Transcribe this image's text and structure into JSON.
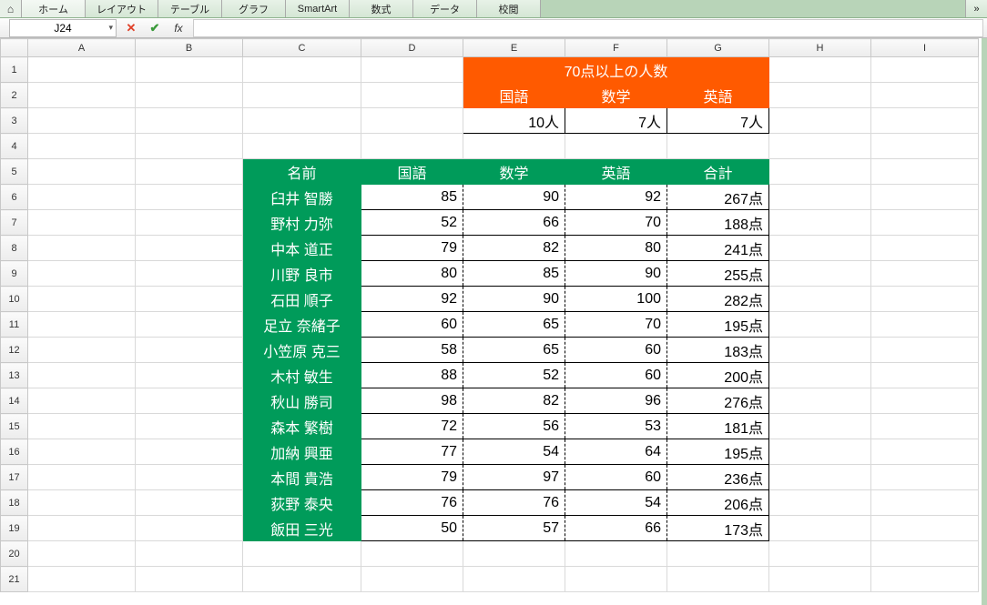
{
  "ribbon": {
    "tabs": [
      "ホーム",
      "レイアウト",
      "テーブル",
      "グラフ",
      "SmartArt",
      "数式",
      "データ",
      "校閲"
    ],
    "active": 0,
    "menu_glyph": "»"
  },
  "namebox": "J24",
  "columns": [
    "A",
    "B",
    "C",
    "D",
    "E",
    "F",
    "G",
    "H",
    "I"
  ],
  "summary": {
    "title": "70点以上の人数",
    "labels": [
      "国語",
      "数学",
      "英語"
    ],
    "counts": [
      "10人",
      "7人",
      "7人"
    ]
  },
  "table": {
    "headers": [
      "名前",
      "国語",
      "数学",
      "英語",
      "合計"
    ],
    "rows": [
      {
        "name": "臼井 智勝",
        "kokugo": 85,
        "sugaku": 90,
        "eigo": 92,
        "total": "267点"
      },
      {
        "name": "野村 力弥",
        "kokugo": 52,
        "sugaku": 66,
        "eigo": 70,
        "total": "188点"
      },
      {
        "name": "中本 道正",
        "kokugo": 79,
        "sugaku": 82,
        "eigo": 80,
        "total": "241点"
      },
      {
        "name": "川野 良市",
        "kokugo": 80,
        "sugaku": 85,
        "eigo": 90,
        "total": "255点"
      },
      {
        "name": "石田 順子",
        "kokugo": 92,
        "sugaku": 90,
        "eigo": 100,
        "total": "282点"
      },
      {
        "name": "足立 奈緒子",
        "kokugo": 60,
        "sugaku": 65,
        "eigo": 70,
        "total": "195点"
      },
      {
        "name": "小笠原 克三",
        "kokugo": 58,
        "sugaku": 65,
        "eigo": 60,
        "total": "183点"
      },
      {
        "name": "木村 敏生",
        "kokugo": 88,
        "sugaku": 52,
        "eigo": 60,
        "total": "200点"
      },
      {
        "name": "秋山 勝司",
        "kokugo": 98,
        "sugaku": 82,
        "eigo": 96,
        "total": "276点"
      },
      {
        "name": "森本 繁樹",
        "kokugo": 72,
        "sugaku": 56,
        "eigo": 53,
        "total": "181点"
      },
      {
        "name": "加納 興亜",
        "kokugo": 77,
        "sugaku": 54,
        "eigo": 64,
        "total": "195点"
      },
      {
        "name": "本間 貴浩",
        "kokugo": 79,
        "sugaku": 97,
        "eigo": 60,
        "total": "236点"
      },
      {
        "name": "荻野 泰央",
        "kokugo": 76,
        "sugaku": 76,
        "eigo": 54,
        "total": "206点"
      },
      {
        "name": "飯田 三光",
        "kokugo": 50,
        "sugaku": 57,
        "eigo": 66,
        "total": "173点"
      }
    ]
  },
  "chart_data": {
    "type": "table",
    "title": "70点以上の人数 / 成績表",
    "summary": {
      "threshold": 70,
      "counts": {
        "国語": 10,
        "数学": 7,
        "英語": 7
      }
    },
    "columns": [
      "名前",
      "国語",
      "数学",
      "英語",
      "合計"
    ],
    "rows": [
      [
        "臼井 智勝",
        85,
        90,
        92,
        267
      ],
      [
        "野村 力弥",
        52,
        66,
        70,
        188
      ],
      [
        "中本 道正",
        79,
        82,
        80,
        241
      ],
      [
        "川野 良市",
        80,
        85,
        90,
        255
      ],
      [
        "石田 順子",
        92,
        90,
        100,
        282
      ],
      [
        "足立 奈緒子",
        60,
        65,
        70,
        195
      ],
      [
        "小笠原 克三",
        58,
        65,
        60,
        183
      ],
      [
        "木村 敏生",
        88,
        52,
        60,
        200
      ],
      [
        "秋山 勝司",
        98,
        82,
        96,
        276
      ],
      [
        "森本 繁樹",
        72,
        56,
        53,
        181
      ],
      [
        "加納 興亜",
        77,
        54,
        64,
        195
      ],
      [
        "本間 貴浩",
        79,
        97,
        60,
        236
      ],
      [
        "荻野 泰央",
        76,
        76,
        54,
        206
      ],
      [
        "飯田 三光",
        50,
        57,
        66,
        173
      ]
    ]
  }
}
